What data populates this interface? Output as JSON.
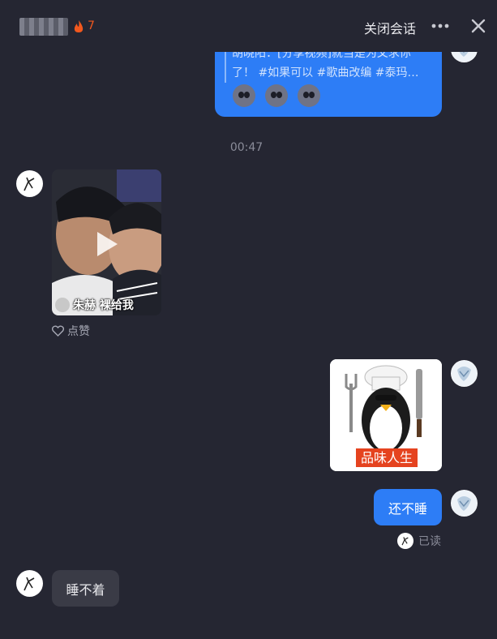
{
  "header": {
    "contact_name": "■■■■",
    "streak_count": "7",
    "close_conversation": "关闭会话"
  },
  "messages": {
    "shared_post": {
      "line1": "胡晓阳：[分享视频]就当是为父求你",
      "line2": "了！ #如果可以 #歌曲改编 #泰玛…"
    },
    "time_divider": "00:47",
    "video": {
      "caption": "朱赫 裸给我"
    },
    "like_label": "点赞",
    "sticker_caption": "品味人生",
    "my_text": "还不睡",
    "read_status": "已读",
    "their_text": "睡不着"
  },
  "colors": {
    "background": "#252632",
    "my_bubble": "#2d7df6",
    "their_bubble": "#3a3b46",
    "streak": "#f2581e"
  }
}
